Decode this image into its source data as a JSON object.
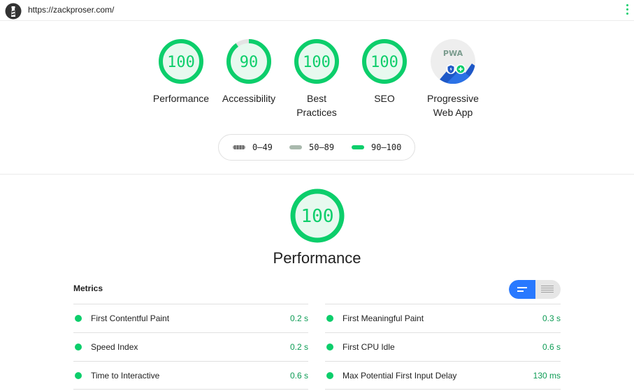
{
  "browser": {
    "url": "https://zackproser.com/"
  },
  "colors": {
    "pass": "#0cce6b",
    "average": "#ffa400",
    "fail": "#ff4e42",
    "accent": "#2979ff"
  },
  "scores": [
    {
      "label": "Performance",
      "score": "100"
    },
    {
      "label": "Accessibility",
      "score": "90"
    },
    {
      "label": "Best Practices",
      "score": "100"
    },
    {
      "label": "SEO",
      "score": "100"
    }
  ],
  "pwa": {
    "label": "Progressive Web App",
    "badge_text": "PWA"
  },
  "legend": [
    {
      "range": "0–49",
      "icon": "triangle-fail-icon"
    },
    {
      "range": "50–89",
      "icon": "square-average-icon"
    },
    {
      "range": "90–100",
      "icon": "circle-pass-icon"
    }
  ],
  "performance": {
    "title": "Performance",
    "score": "100"
  },
  "metrics": {
    "title": "Metrics",
    "left": [
      {
        "name": "First Contentful Paint",
        "value": "0.2 s"
      },
      {
        "name": "Speed Index",
        "value": "0.2 s"
      },
      {
        "name": "Time to Interactive",
        "value": "0.6 s"
      }
    ],
    "right": [
      {
        "name": "First Meaningful Paint",
        "value": "0.3 s"
      },
      {
        "name": "First CPU Idle",
        "value": "0.6 s"
      },
      {
        "name": "Max Potential First Input Delay",
        "value": "130 ms"
      }
    ]
  }
}
